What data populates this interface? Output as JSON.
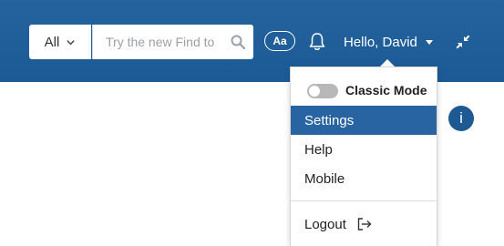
{
  "header": {
    "scope_select_value": "All",
    "search_placeholder": "Try the new Find to",
    "text_size_button": "Aa",
    "greeting": "Hello, David"
  },
  "user_dropdown": {
    "classic_mode_label": "Classic Mode",
    "classic_mode_enabled": false,
    "items": [
      {
        "label": "Settings",
        "active": true
      },
      {
        "label": "Help",
        "active": false
      },
      {
        "label": "Mobile",
        "active": false
      }
    ],
    "logout_label": "Logout"
  },
  "info_badge": "i",
  "icons": {
    "scope": "chevron-down-icon",
    "search": "search-icon",
    "notifications": "bell-icon",
    "user": "caret-down-icon",
    "collapse": "collapse-arrows-icon",
    "logout": "logout-icon"
  },
  "colors": {
    "header_bg": "#1f5e9a",
    "active_item_bg": "#2864a1",
    "badge_bg": "#1d5a94",
    "toggle_off": "#b8b8b8"
  }
}
